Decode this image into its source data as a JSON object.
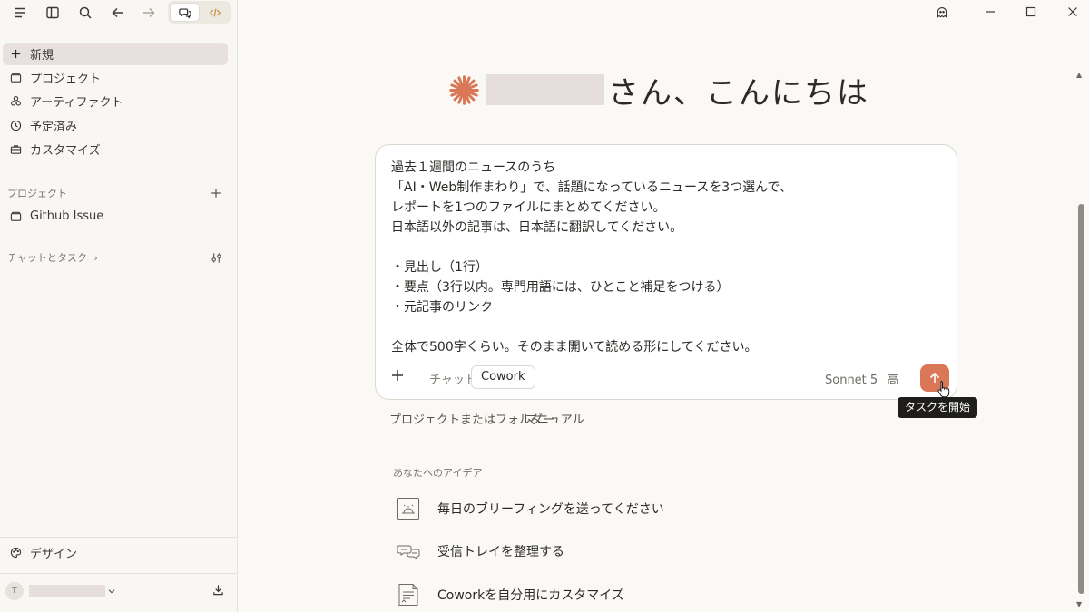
{
  "sidebar": {
    "nav": [
      {
        "label": "新規",
        "icon": "plus-icon"
      },
      {
        "label": "プロジェクト",
        "icon": "folder-icon"
      },
      {
        "label": "アーティファクト",
        "icon": "artifact-icon"
      },
      {
        "label": "予定済み",
        "icon": "clock-icon"
      },
      {
        "label": "カスタマイズ",
        "icon": "briefcase-icon"
      }
    ],
    "projects_label": "プロジェクト",
    "projects": [
      {
        "label": "Github Issue"
      }
    ],
    "chats_label": "チャットとタスク",
    "chats_chevron": "›",
    "design_label": "デザイン",
    "user_initial": "T"
  },
  "main": {
    "greeting": "さん、こんにちは",
    "composer_lines": [
      "過去１週間のニュースのうち",
      "「AI・Web制作まわり」で、話題になっているニュースを3つ選んで、",
      "レポートを1つのファイルにまとめてください。",
      "日本語以外の記事は、日本語に翻訳してください。",
      "",
      "・見出し（1行）",
      "・要点（3行以内。専門用語には、ひとこと補足をつける）",
      "・元記事のリンク",
      "",
      "全体で500字くらい。そのまま開いて読める形にしてください。"
    ],
    "mode_chat": "チャット",
    "mode_cowork": "Cowork",
    "model": "Sonnet 5",
    "effort": "高",
    "send_tooltip": "タスクを開始",
    "project_folder": "プロジェクトまたはフォルダー",
    "manual": "マニュアル",
    "ideas_label": "あなたへのアイデア",
    "ideas": [
      {
        "label": "毎日のブリーフィングを送ってください",
        "icon": "briefing-bell-icon"
      },
      {
        "label": "受信トレイを整理する",
        "icon": "inbox-bubbles-icon"
      },
      {
        "label": "Coworkを自分用にカスタマイズ",
        "icon": "document-icon"
      }
    ]
  },
  "colors": {
    "accent": "#d97757",
    "active_nav": "#e7e0df",
    "background": "#faf9f5"
  }
}
